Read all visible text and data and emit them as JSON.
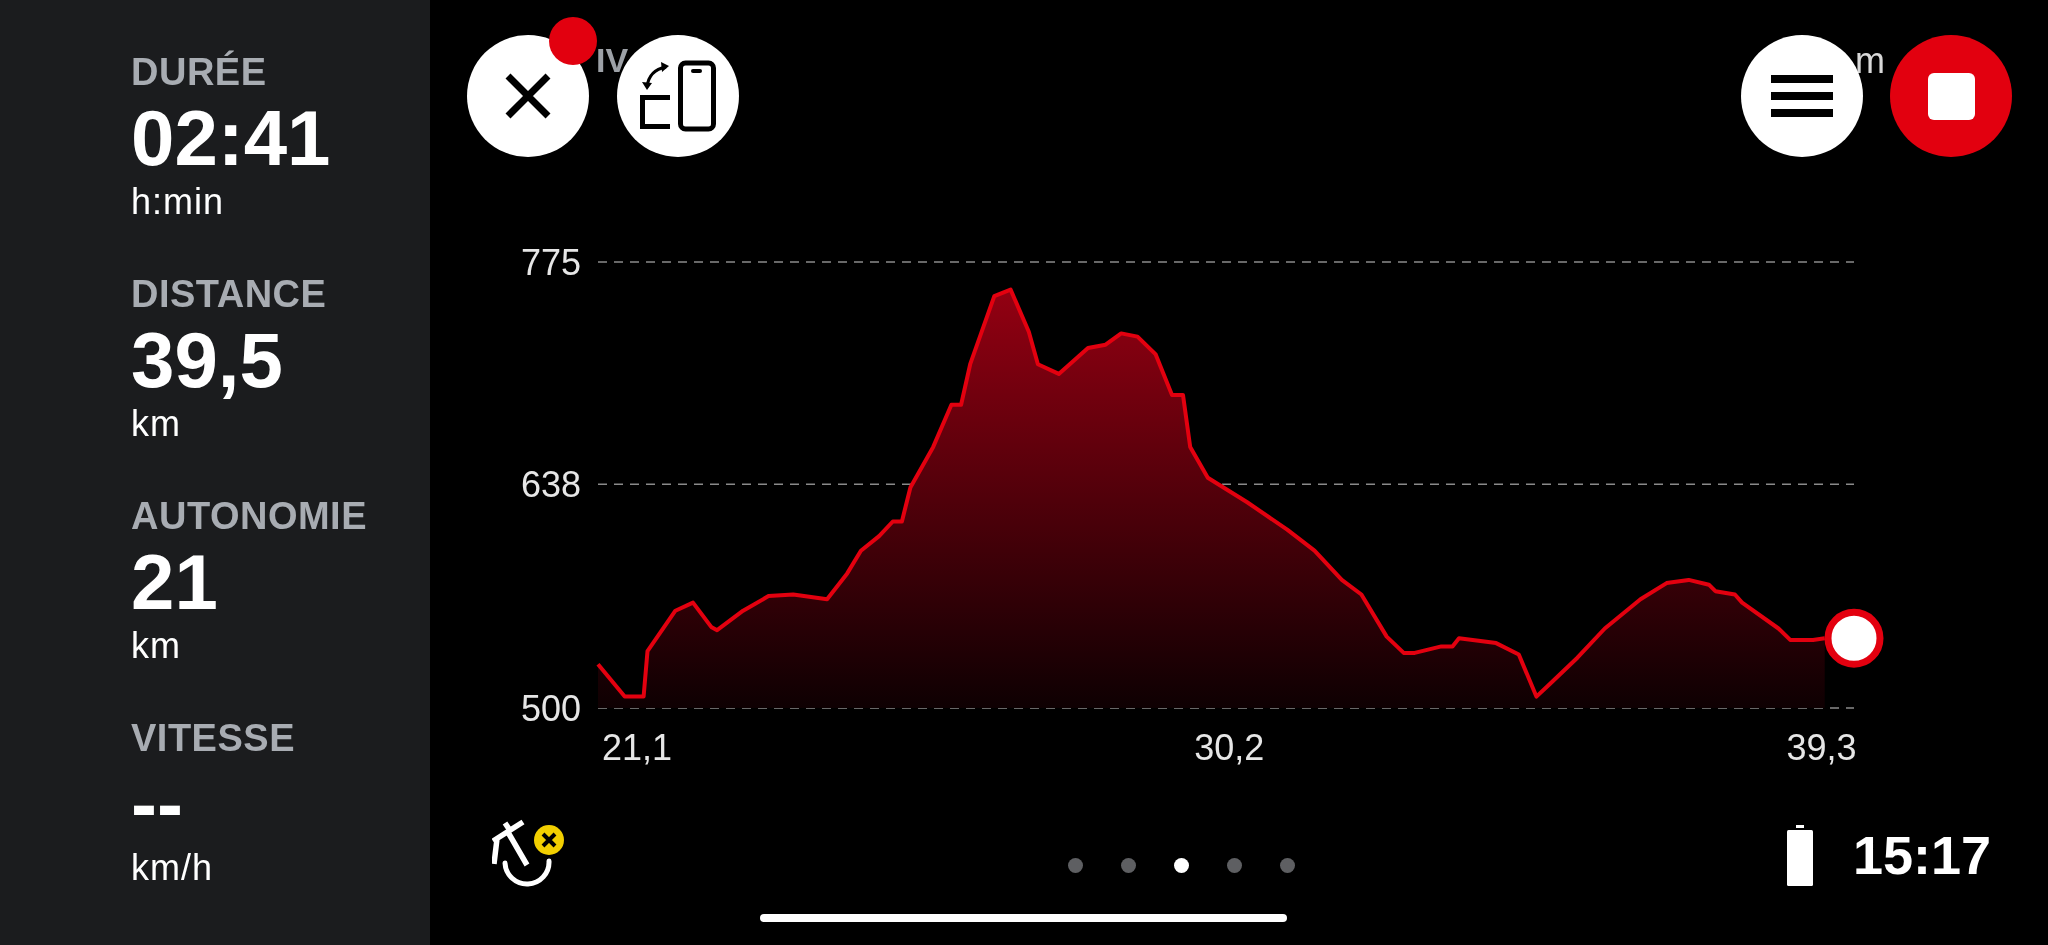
{
  "sidebar": {
    "stats": [
      {
        "label": "DURÉE",
        "value": "02:41",
        "unit": "h:min"
      },
      {
        "label": "DISTANCE",
        "value": "39,5",
        "unit": "km"
      },
      {
        "label": "AUTONOMIE",
        "value": "21",
        "unit": "km"
      },
      {
        "label": "VITESSE",
        "value": "--",
        "unit": "km/h"
      }
    ]
  },
  "header": {
    "partial_label_left": "IV",
    "partial_label_right": "m",
    "left_buttons": [
      {
        "kind": "close",
        "badge": true
      },
      {
        "kind": "rotate",
        "badge": false
      }
    ],
    "right_buttons": [
      {
        "kind": "menu",
        "badge": false
      },
      {
        "kind": "stop",
        "badge": false
      }
    ]
  },
  "chart": {
    "chart_data": {
      "type": "area",
      "x": [
        20.5,
        20.91,
        21.2,
        21.26,
        21.69,
        21.96,
        22.24,
        22.33,
        22.73,
        23.12,
        23.5,
        24.02,
        24.33,
        24.54,
        24.82,
        25.03,
        25.17,
        25.3,
        25.65,
        25.93,
        26.08,
        26.22,
        26.59,
        26.84,
        27.12,
        27.26,
        27.58,
        28.03,
        28.3,
        28.54,
        28.79,
        29.07,
        29.32,
        29.49,
        29.6,
        29.87,
        30.47,
        31.09,
        31.51,
        31.93,
        32.23,
        32.62,
        32.88,
        33.05,
        33.46,
        33.63,
        33.73,
        34.3,
        34.65,
        34.92,
        35.13,
        35.55,
        35.97,
        36.52,
        36.92,
        37.26,
        37.57,
        37.67,
        37.97,
        38.08,
        38.64,
        38.82,
        39.17,
        39.35
      ],
      "series": [
        {
          "color": "#e3000f",
          "values": [
            527,
            507,
            507,
            535,
            560,
            565,
            550,
            548,
            560,
            569,
            570,
            567,
            583,
            597,
            606,
            615,
            615,
            636,
            661,
            687,
            687,
            712,
            754,
            758,
            732,
            712,
            706,
            722,
            724,
            731,
            729,
            718,
            693,
            693,
            661,
            642,
            627,
            610,
            597,
            579,
            570,
            544,
            534,
            534,
            538,
            538,
            543,
            540,
            533,
            507,
            515,
            531,
            549,
            567,
            577,
            579,
            576,
            572,
            570,
            565,
            549,
            542,
            542,
            543
          ]
        }
      ],
      "xlim": [
        20.5,
        39.8
      ],
      "ylim": [
        500,
        775
      ],
      "xticks": [
        {
          "value": 21.1,
          "label": "21,1"
        },
        {
          "value": 30.2,
          "label": "30,2"
        },
        {
          "value": 39.3,
          "label": "39,3"
        }
      ],
      "yticks": [
        775,
        638,
        500
      ]
    }
  },
  "footer": {
    "page_dots": [
      {
        "selected": false
      },
      {
        "selected": false
      },
      {
        "selected": true
      },
      {
        "selected": false
      },
      {
        "selected": false
      }
    ],
    "clock": "15:17"
  }
}
